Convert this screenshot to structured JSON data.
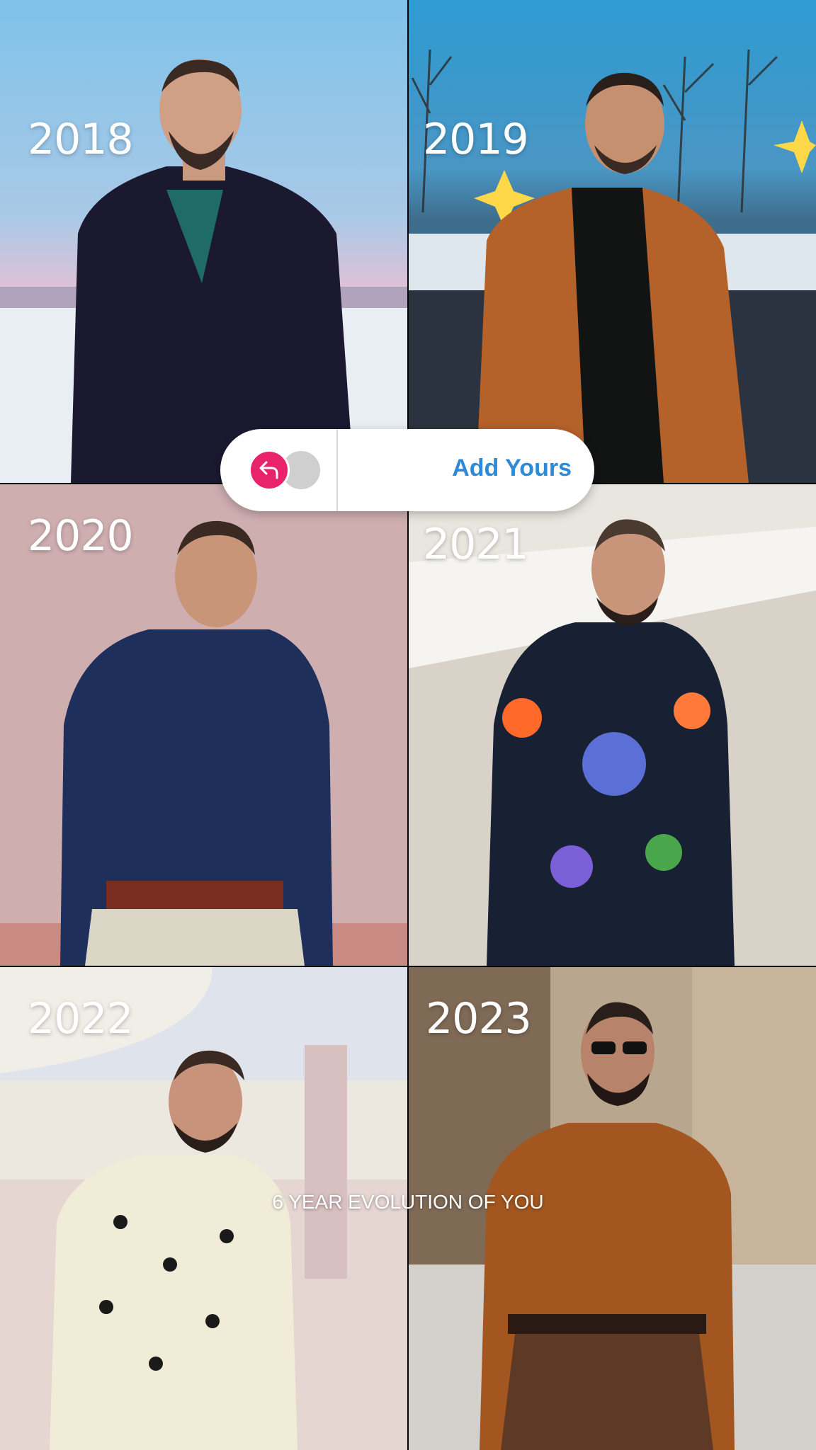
{
  "story": {
    "caption": "6 YEAR EVOLUTION OF YOU",
    "sticker": {
      "label": "Add Yours",
      "icon": "reply-arrow-icon",
      "accent_color": "#e8226b",
      "label_color": "#2e8ad6"
    },
    "tiles": [
      {
        "year": "2018"
      },
      {
        "year": "2019"
      },
      {
        "year": "2020"
      },
      {
        "year": "2021"
      },
      {
        "year": "2022"
      },
      {
        "year": "2023"
      }
    ]
  }
}
